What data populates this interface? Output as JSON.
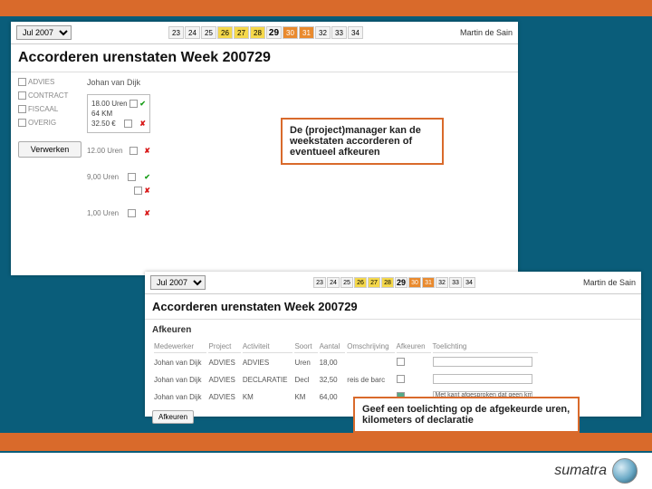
{
  "colors": {
    "brand_orange": "#d96a2b",
    "brand_teal": "#0a5d7a"
  },
  "header": {
    "month_select": "Jul 2007",
    "days": [
      {
        "n": "23",
        "cls": ""
      },
      {
        "n": "24",
        "cls": ""
      },
      {
        "n": "25",
        "cls": ""
      },
      {
        "n": "26",
        "cls": "yel"
      },
      {
        "n": "27",
        "cls": "yel"
      },
      {
        "n": "28",
        "cls": "yel"
      },
      {
        "n": "29",
        "cls": "cur"
      },
      {
        "n": "30",
        "cls": "org"
      },
      {
        "n": "31",
        "cls": "org"
      },
      {
        "n": "32",
        "cls": ""
      },
      {
        "n": "33",
        "cls": ""
      },
      {
        "n": "34",
        "cls": ""
      }
    ],
    "username": "Martin de Sain"
  },
  "title": "Accorderen urenstaten Week 200729",
  "panel1": {
    "person": "Johan van Dijk",
    "stats": {
      "uren": "18.00 Uren",
      "km": "64 KM",
      "eur": "32.50 €"
    },
    "cats": [
      "ADVIES",
      "CONTRACT",
      "FISCAAL",
      "OVERIG"
    ],
    "lines": [
      {
        "text": "12.00 Uren"
      },
      {
        "text": "9,00 Uren"
      },
      {
        "text": "1,00 Uren"
      }
    ],
    "button": "Verwerken"
  },
  "panel2": {
    "subtitle": "Afkeuren",
    "columns": [
      "Medewerker",
      "Project",
      "Activiteit",
      "Soort",
      "Aantal",
      "Omschrijving",
      "Afkeuren",
      "Toelichting"
    ],
    "rows": [
      {
        "med": "Johan van Dijk",
        "proj": "ADVIES",
        "act": "ADVIES",
        "soort": "Uren",
        "aantal": "18,00",
        "oms": "",
        "toe": ""
      },
      {
        "med": "Johan van Dijk",
        "proj": "ADVIES",
        "act": "DECLARATIE",
        "soort": "Decl",
        "aantal": "32,50",
        "oms": "reis de barc",
        "toe": ""
      },
      {
        "med": "Johan van Dijk",
        "proj": "ADVIES",
        "act": "KM",
        "soort": "KM",
        "aantal": "64,00",
        "oms": "",
        "toe": "Met kant afgesproken dat geen km's gedeclareerd worden"
      }
    ],
    "button": "Afkeuren"
  },
  "callouts": {
    "c1": "De (project)manager kan de weekstaten accorderen of eventueel afkeuren",
    "c2": "Geef een toelichting op de afgekeurde uren, kilometers of declaratie"
  },
  "logo_text": "sumatra"
}
